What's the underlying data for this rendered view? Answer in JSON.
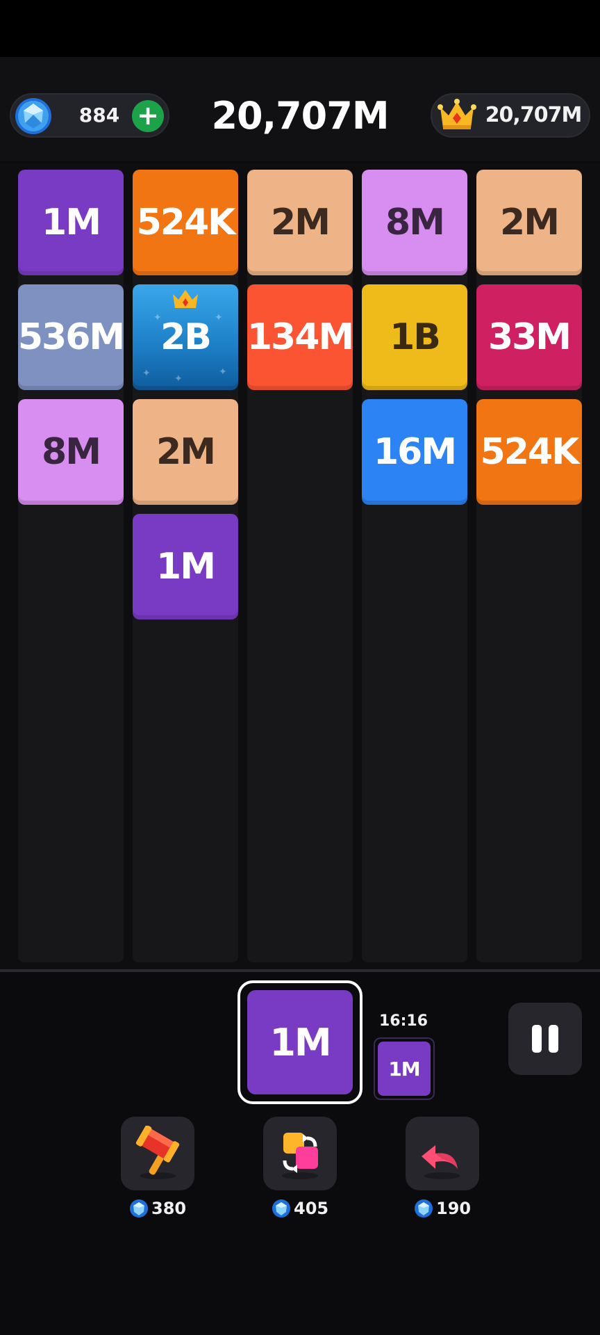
{
  "header": {
    "gems": "884",
    "add_label": "+",
    "score": "20,707M",
    "best_score": "20,707M"
  },
  "board": {
    "columns": [
      [
        {
          "label": "1M",
          "bg": "#7a3bc4",
          "fg": "#ffffff"
        },
        {
          "label": "536M",
          "bg": "#7f91c1",
          "fg": "#ffffff"
        },
        {
          "label": "8M",
          "bg": "#d88ef0",
          "fg": "#3a2540"
        }
      ],
      [
        {
          "label": "524K",
          "bg": "#f27514",
          "fg": "#ffffff"
        },
        {
          "label": "2B",
          "bg": "#1f82c9",
          "fg": "#ffffff",
          "special": "crown"
        },
        {
          "label": "2M",
          "bg": "#eeb386",
          "fg": "#3c2a20"
        },
        {
          "label": "1M",
          "bg": "#7a3bc4",
          "fg": "#ffffff"
        }
      ],
      [
        {
          "label": "2M",
          "bg": "#eeb386",
          "fg": "#3c2a20"
        },
        {
          "label": "134M",
          "bg": "#fb5433",
          "fg": "#ffffff"
        }
      ],
      [
        {
          "label": "8M",
          "bg": "#d88ef0",
          "fg": "#3a2540"
        },
        {
          "label": "1B",
          "bg": "#eebb1a",
          "fg": "#3a2a10"
        },
        {
          "label": "16M",
          "bg": "#2c83f3",
          "fg": "#ffffff"
        }
      ],
      [
        {
          "label": "2M",
          "bg": "#eeb386",
          "fg": "#3c2a20"
        },
        {
          "label": "33M",
          "bg": "#cf2162",
          "fg": "#ffffff"
        },
        {
          "label": "524K",
          "bg": "#f27514",
          "fg": "#ffffff"
        }
      ]
    ]
  },
  "current_tile": {
    "label": "1M",
    "bg": "#7a3bc4"
  },
  "next_tile": {
    "label": "1M",
    "bg": "#7a3bc4",
    "timer": "16:16"
  },
  "powerups": [
    {
      "name": "hammer",
      "icon": "hammer-icon",
      "cost": "380"
    },
    {
      "name": "swap",
      "icon": "swap-icon",
      "cost": "405"
    },
    {
      "name": "undo",
      "icon": "undo-icon",
      "cost": "190"
    }
  ]
}
